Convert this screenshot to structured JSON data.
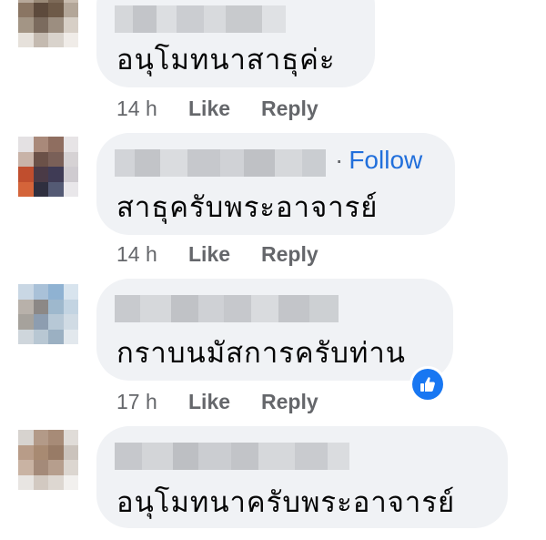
{
  "comments": [
    {
      "text": "อนุโมทนาสาธุค่ะ",
      "time": "14 h",
      "like_label": "Like",
      "reply_label": "Reply"
    },
    {
      "text": "สาธุครับพระอาจารย์",
      "follow_label": "Follow",
      "follow_dot": "·",
      "time": "14 h",
      "like_label": "Like",
      "reply_label": "Reply"
    },
    {
      "text": "กราบนมัสการครับท่าน",
      "time": "17 h",
      "like_label": "Like",
      "reply_label": "Reply",
      "reaction": "like-icon"
    },
    {
      "text": "อนุโมทนาครับพระอาจารย์"
    }
  ],
  "colors": {
    "bubble": "#f0f2f5",
    "link": "#216fdb",
    "meta": "#65676b",
    "like_blue": "#1877f2"
  }
}
